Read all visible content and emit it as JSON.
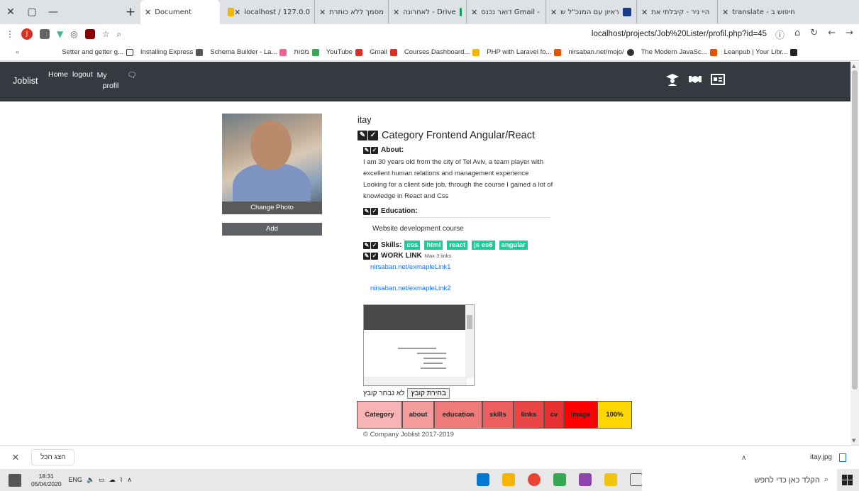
{
  "browser": {
    "tabs": [
      {
        "label": "translate - חיפוש ב",
        "color": "#4285f4"
      },
      {
        "label": "היי ניר - קיבלתי את",
        "color": "#d93025"
      },
      {
        "label": "ראיון עם המנכ\"ל ש",
        "color": "#1a3a8a"
      },
      {
        "label": "דואר נכנס Gmail -",
        "color": "#d93025"
      },
      {
        "label": "לאחרונה - Drive",
        "color": "#0f9d58"
      },
      {
        "label": "מסמך ללא כותרת",
        "color": "#4285f4"
      },
      {
        "label": "localhost / 127.0.0",
        "color": "#f4b400"
      },
      {
        "label": "Document",
        "color": "#ffffff"
      }
    ],
    "url": "localhost/projects/Job%20Lister/profil.php?id=45",
    "avatar_letter": "J",
    "bookmarks": [
      {
        "label": "Setter and getter g...",
        "color": "#888888"
      },
      {
        "label": "Installing Express",
        "color": "#222222"
      },
      {
        "label": "Schema Builder - La...",
        "color": "#444444"
      },
      {
        "label": "מפות",
        "color": "#f06292"
      },
      {
        "label": "YouTube",
        "color": "#34a853"
      },
      {
        "label": "Gmail",
        "color": "#d93025"
      },
      {
        "label": "Courses Dashboard...",
        "color": "#d93025"
      },
      {
        "label": "PHP with Laravel fo...",
        "color": "#f4b400"
      },
      {
        "label": "nirsaban.net/mojo/",
        "color": "#e65100"
      },
      {
        "label": "The Modern JavaSc...",
        "color": "#333333"
      },
      {
        "label": "Leanpub | Your Libr...",
        "color": "#e65100"
      }
    ]
  },
  "navbar": {
    "brand": "Joblist",
    "home": "Home",
    "logout": "logout",
    "my_profil_1": "My",
    "my_profil_2": "profil"
  },
  "profile": {
    "change_photo": "Change Photo",
    "add": "Add",
    "username": "itay",
    "category_title": "Category Frontend Angular/React",
    "about_label": "About:",
    "about_text": "I am 30 years old from the city of Tel Aviv, a team player with excellent human relations and management experience Looking for a client side job, through the course I gained a lot of knowledge in React and Css",
    "education_label": "Education:",
    "education_text": "Website development course",
    "skills_label": "Skills:",
    "skills": [
      "css",
      "html",
      "react",
      "js es6",
      "angular"
    ],
    "worklink_label": "WORK LINK",
    "worklink_note": "Max 3 links",
    "links": [
      "nirsaban.net/exmapleLink1",
      "nirsaban.net/exmapleLink2"
    ],
    "file_button": "בחירת קובץ",
    "file_none": "לא נבחר קובץ"
  },
  "progress": [
    {
      "label": "Category",
      "color": "#f8b4b4",
      "width": 64
    },
    {
      "label": "about",
      "color": "#f39c9c",
      "width": 45
    },
    {
      "label": "education",
      "color": "#ef7a7a",
      "width": 68
    },
    {
      "label": "skills",
      "color": "#ec5f5f",
      "width": 44
    },
    {
      "label": "links",
      "color": "#ea4646",
      "width": 43
    },
    {
      "label": "cv",
      "color": "#e83030",
      "width": 28
    },
    {
      "label": "image",
      "color": "#ff0000",
      "width": 47
    },
    {
      "label": "100%",
      "color": "#ffd600",
      "width": 49
    }
  ],
  "footer": "© Company Joblist 2017-2019",
  "download": {
    "show_all": "הצג הכל",
    "filename": "itay.jpg"
  },
  "taskbar": {
    "time": "18:31",
    "date": "05/04/2020",
    "lang": "ENG",
    "search": "הקלד כאן כדי לחפש"
  }
}
